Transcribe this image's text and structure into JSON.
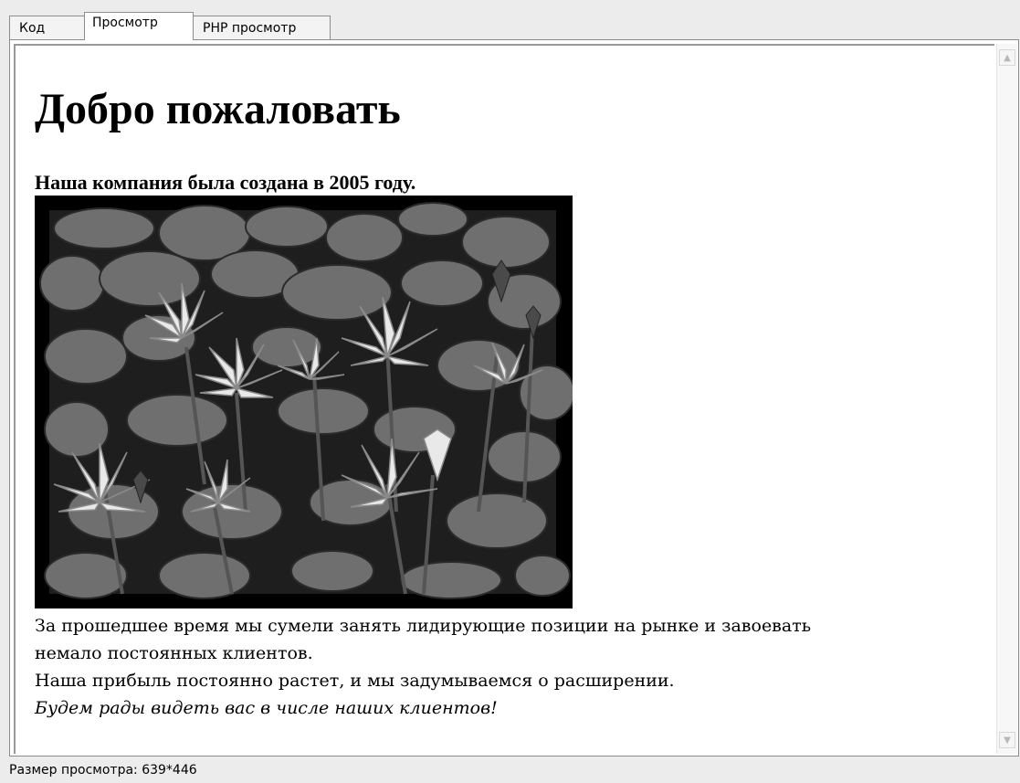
{
  "tabs": [
    {
      "label": "Код",
      "active": false
    },
    {
      "label": "Просмотр",
      "active": true
    },
    {
      "label": "PHP просмотр",
      "active": false
    }
  ],
  "page": {
    "heading": "Добро пожаловать",
    "founded": "Наша компания была создана в 2005 году.",
    "image_alt_icon": "water-lilies-photo",
    "paragraph_line1": "За прошедшее время мы сумели занять лидирующие позиции на рынке и завоевать",
    "paragraph_line2": "немало постоянных клиентов.",
    "paragraph_line3": "Наша прибыль постоянно растет, и мы задумываемся о расширении.",
    "paragraph_line4": "Будем рады видеть вас в числе наших клиентов!"
  },
  "scrollbar": {
    "up_icon": "chevron-up-icon",
    "down_icon": "chevron-down-icon"
  },
  "status": {
    "text": "Размер просмотра: 639*446"
  }
}
